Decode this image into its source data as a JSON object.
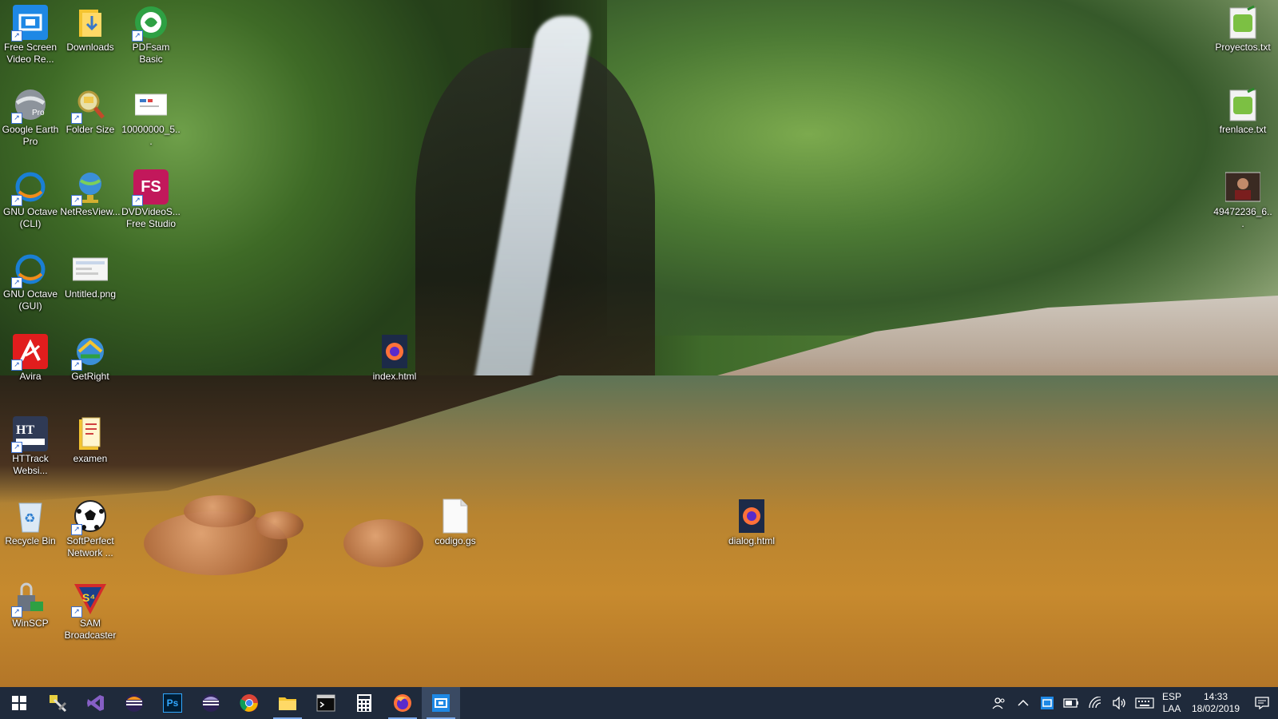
{
  "desktop_icons": [
    {
      "name": "free-screen-video-recorder-icon",
      "label": "Free Screen Video Re...",
      "color": "#1e88e5"
    },
    {
      "name": "downloads-folder-icon",
      "label": "Downloads",
      "color": "#f4c430"
    },
    {
      "name": "pdfsam-icon",
      "label": "PDFsam Basic",
      "color": "#2ea043"
    },
    {
      "name": "google-earth-pro-icon",
      "label": "Google Earth Pro",
      "color": "#9aa0a6"
    },
    {
      "name": "folder-size-icon",
      "label": "Folder Size",
      "color": "#e0c060"
    },
    {
      "name": "image-file-icon",
      "label": "10000000_5...",
      "color": "#ffffff"
    },
    {
      "name": "gnu-octave-cli-icon",
      "label": "GNU Octave (CLI)",
      "color": "#1a7fd4"
    },
    {
      "name": "netresview-icon",
      "label": "NetResView...",
      "color": "#3b8fd8"
    },
    {
      "name": "dvdvideosoft-icon",
      "label": "DVDVideoS... Free Studio",
      "color": "#c2185b"
    },
    {
      "name": "gnu-octave-gui-icon",
      "label": "GNU Octave (GUI)",
      "color": "#1a7fd4"
    },
    {
      "name": "untitled-png-icon",
      "label": "Untitled.png",
      "color": "#f5f5f5"
    },
    {
      "name": "avira-icon",
      "label": "Avira",
      "color": "#e11d1d"
    },
    {
      "name": "getright-icon",
      "label": "GetRight",
      "color": "#2aa84a"
    },
    {
      "name": "index-html-firefox-icon",
      "label": "index.html",
      "color": "#ff7139"
    },
    {
      "name": "httrack-icon",
      "label": "HTTrack Websi...",
      "color": "#3b4a6b"
    },
    {
      "name": "examen-folder-icon",
      "label": "examen",
      "color": "#f4c430"
    },
    {
      "name": "recycle-bin-icon",
      "label": "Recycle Bin",
      "color": "#b9d8f2"
    },
    {
      "name": "softperfect-network-icon",
      "label": "SoftPerfect Network ...",
      "color": "#ffffff"
    },
    {
      "name": "codigo-gs-file-icon",
      "label": "codigo.gs",
      "color": "#ffffff"
    },
    {
      "name": "dialog-html-firefox-icon",
      "label": "dialog.html",
      "color": "#ff7139"
    },
    {
      "name": "winscp-icon",
      "label": "WinSCP",
      "color": "#4a8ad8"
    },
    {
      "name": "sam-broadcaster-icon",
      "label": "SAM Broadcaster",
      "color": "#d42b2b"
    },
    {
      "name": "proyectos-txt-icon",
      "label": "Proyectos.txt",
      "color": "#7cc043"
    },
    {
      "name": "frenlace-txt-icon",
      "label": "frenlace.txt",
      "color": "#7cc043"
    },
    {
      "name": "photo-thumbnail-icon",
      "label": "49472236_6...",
      "color": "#6b4a3a"
    }
  ],
  "icon_glyphs": {
    "pdfsam": "◔",
    "earth": "Pro",
    "octave": "◠",
    "fs": "FS",
    "avira": "ᐱ",
    "httrack": "HT",
    "sam": "S⁴",
    "winscp": "🔒",
    "recycle": "♻",
    "soccer": "⚽",
    "firefox": "●"
  },
  "taskbar": {
    "buttons": [
      {
        "name": "start-button-windows-icon"
      },
      {
        "name": "taskbar-tool-icon"
      },
      {
        "name": "taskbar-visual-studio-icon"
      },
      {
        "name": "taskbar-eclipse-icon"
      },
      {
        "name": "taskbar-photoshop-icon",
        "text": "Ps"
      },
      {
        "name": "taskbar-eclipse-2-icon"
      },
      {
        "name": "taskbar-chrome-icon"
      },
      {
        "name": "taskbar-file-explorer-icon"
      },
      {
        "name": "taskbar-terminal-icon"
      },
      {
        "name": "taskbar-calculator-icon"
      },
      {
        "name": "taskbar-firefox-icon"
      },
      {
        "name": "taskbar-screen-recorder-icon"
      }
    ],
    "lang_top": "ESP",
    "lang_bottom": "LAA",
    "time": "14:33",
    "date": "18/02/2019"
  }
}
